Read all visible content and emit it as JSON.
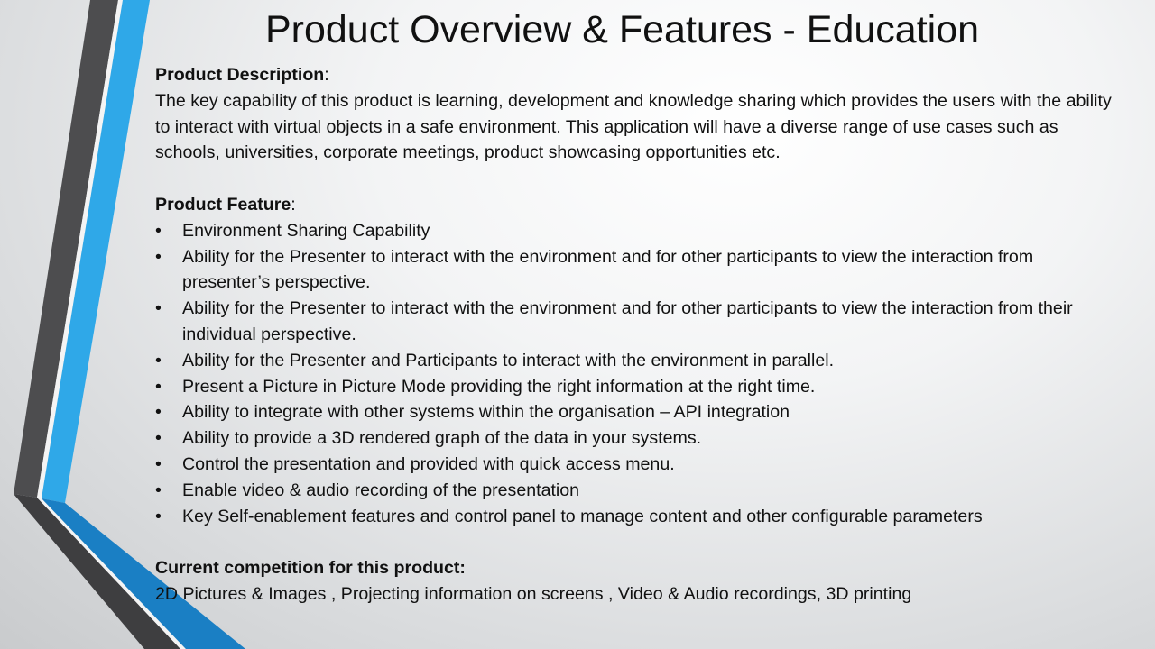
{
  "slide": {
    "title": "Product Overview & Features - Education"
  },
  "description": {
    "heading": "Product Description",
    "colon": ":",
    "text": "The key capability of this product is learning, development and knowledge sharing which provides the users with the ability to interact with virtual objects in a safe environment. This application will have a diverse range of use cases such as schools, universities, corporate meetings, product showcasing opportunities etc."
  },
  "features": {
    "heading": "Product Feature",
    "colon": ":",
    "bullet": "•",
    "items": [
      "Environment Sharing Capability",
      "Ability for the Presenter to interact with the environment and for other participants to view the interaction from presenter’s perspective.",
      "Ability for the Presenter to interact with the environment and for other participants to view the interaction from their individual perspective.",
      "Ability for the Presenter and Participants to interact with the environment in parallel.",
      "Present a Picture in Picture Mode providing the right information at the right time.",
      "Ability to integrate with other systems within the organisation – API integration",
      "Ability to provide a 3D rendered graph of the data in your systems.",
      "Control the presentation and provided with quick access menu.",
      "Enable video & audio recording of the presentation",
      "Key Self-enablement features and control panel to manage content and other configurable parameters"
    ]
  },
  "competition": {
    "heading": "Current competition for this product:",
    "text": "2D Pictures & Images , Projecting information on screens , Video & Audio recordings, 3D printing"
  },
  "colors": {
    "dark_stripe": "#4d4d4f",
    "blue_stripe": "#2fa8e8",
    "deep_blue": "#1a7fc4"
  }
}
